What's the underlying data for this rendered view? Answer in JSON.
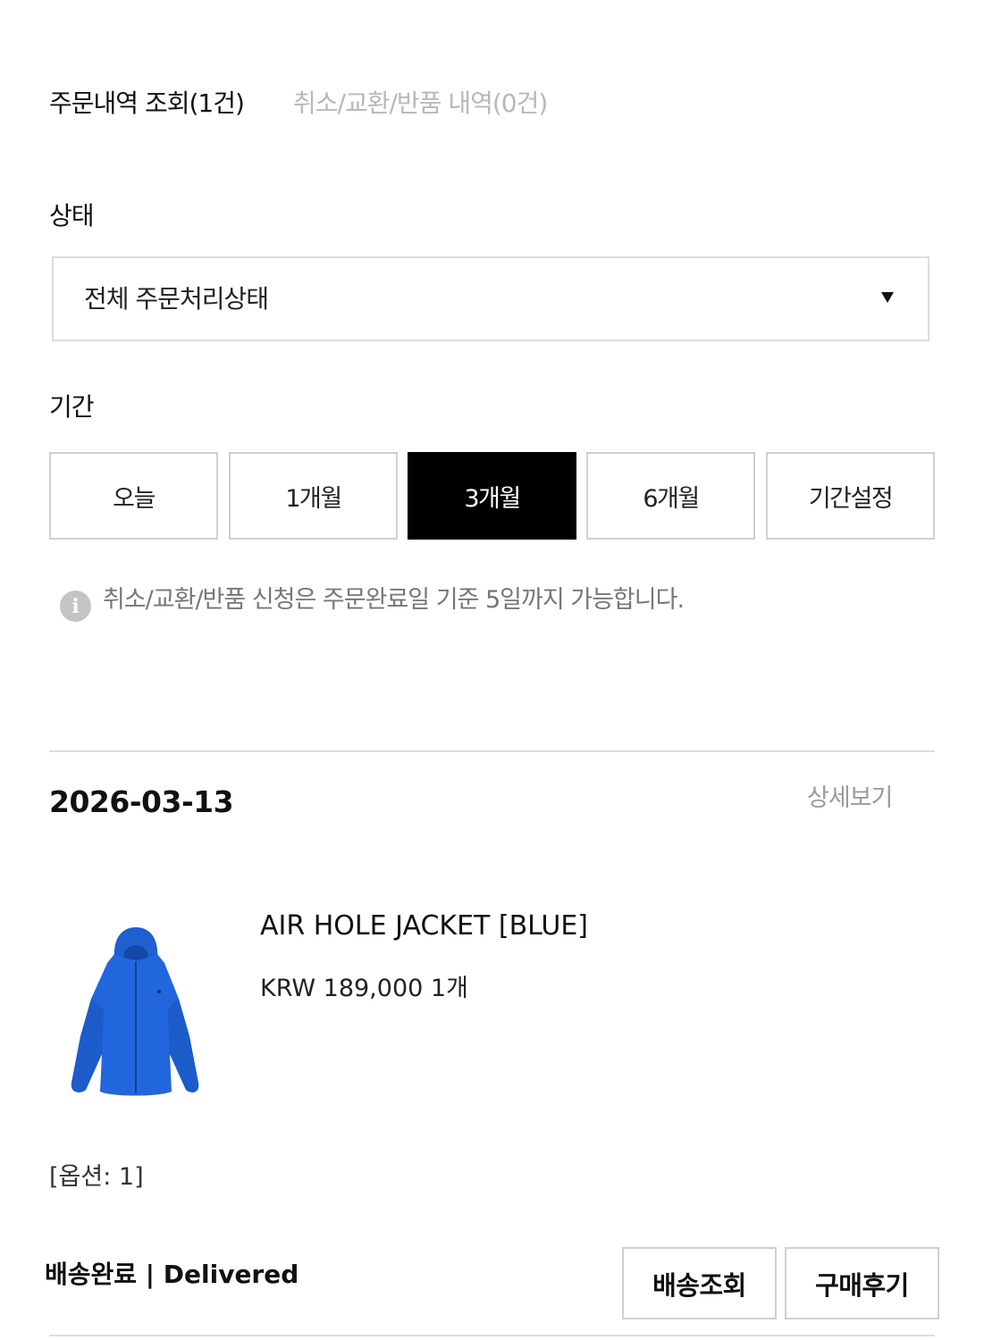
{
  "tabs": {
    "active_label": "주문내역 조회(1건)",
    "inactive_label": "취소/교환/반품 내역(0건)"
  },
  "status_filter": {
    "label": "상태",
    "selected": "전체 주문처리상태"
  },
  "period_filter": {
    "label": "기간",
    "options": [
      "오늘",
      "1개월",
      "3개월",
      "6개월",
      "기간설정"
    ],
    "selected": "3개월"
  },
  "notice": {
    "icon": "info-icon",
    "icon_glyph": "i",
    "text": "취소/교환/반품 신청은 주문완료일 기준 5일까지 가능합니다."
  },
  "order": {
    "date": "2026-03-13",
    "detail_link": "상세보기",
    "product": {
      "name": "AIR HOLE JACKET [BLUE]",
      "price_line": "KRW 189,000 1개",
      "option": "[옵션: 1]",
      "image_color": "#1f63d8"
    },
    "status": "배송완료 | Delivered",
    "actions": {
      "track_label": "배송조회",
      "review_label": "구매후기"
    }
  }
}
